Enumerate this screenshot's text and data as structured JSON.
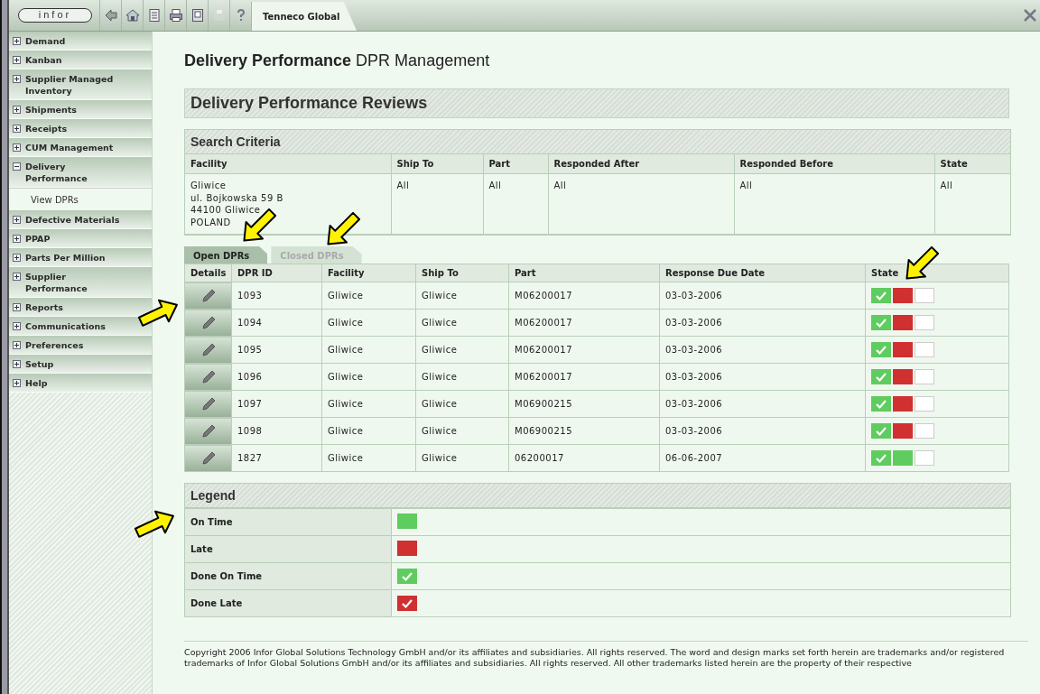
{
  "topbar": {
    "logo": "infor",
    "toolbar": [
      {
        "kind": "back",
        "disabled": false
      },
      {
        "kind": "home",
        "disabled": false
      },
      {
        "kind": "document",
        "disabled": false
      },
      {
        "kind": "print",
        "disabled": false
      },
      {
        "kind": "page",
        "disabled": false
      },
      {
        "kind": "save",
        "disabled": true
      },
      {
        "kind": "help",
        "disabled": false
      }
    ],
    "tab": "Tenneco Global"
  },
  "sidebar": {
    "items": [
      {
        "label": "Demand",
        "expanded": false
      },
      {
        "label": "Kanban",
        "expanded": false
      },
      {
        "label": "Supplier Managed Inventory",
        "expanded": false
      },
      {
        "label": "Shipments",
        "expanded": false
      },
      {
        "label": "Receipts",
        "expanded": false
      },
      {
        "label": "CUM Management",
        "expanded": false
      },
      {
        "label": "Delivery Performance",
        "expanded": true,
        "children": [
          {
            "label": "View DPRs"
          }
        ]
      },
      {
        "label": "Defective Materials",
        "expanded": false
      },
      {
        "label": "PPAP",
        "expanded": false
      },
      {
        "label": "Parts Per Million",
        "expanded": false
      },
      {
        "label": "Supplier Performance",
        "expanded": false
      },
      {
        "label": "Reports",
        "expanded": false
      },
      {
        "label": "Communications",
        "expanded": false
      },
      {
        "label": "Preferences",
        "expanded": false
      },
      {
        "label": "Setup",
        "expanded": false
      },
      {
        "label": "Help",
        "expanded": false
      }
    ]
  },
  "page_title": {
    "bold": "Delivery Performance",
    "rest": "DPR Management"
  },
  "section_title": "Delivery Performance Reviews",
  "search_criteria": {
    "title": "Search Criteria",
    "columns": [
      "Facility",
      "Ship To",
      "Part",
      "Responded After",
      "Responded Before",
      "State"
    ],
    "values": [
      [
        "Gliwice",
        "ul. Bojkowska 59 B",
        "44100 Gliwice",
        "POLAND"
      ],
      [
        "All"
      ],
      [
        "All"
      ],
      [
        "All"
      ],
      [
        "All"
      ],
      [
        "All"
      ]
    ]
  },
  "tabs": [
    {
      "label": "Open DPRs",
      "selected": true
    },
    {
      "label": "Closed DPRs",
      "selected": false
    }
  ],
  "dpr_table": {
    "columns": [
      "Details",
      "DPR ID",
      "Facility",
      "Ship To",
      "Part",
      "Response Due Date",
      "State"
    ],
    "rows": [
      {
        "id": "1093",
        "facility": "Gliwice",
        "ship_to": "Gliwice",
        "part": "M06200017",
        "due": "03-03-2006",
        "state": [
          {
            "kind": "done_on_time"
          },
          {
            "kind": "late"
          },
          {
            "kind": "empty"
          }
        ]
      },
      {
        "id": "1094",
        "facility": "Gliwice",
        "ship_to": "Gliwice",
        "part": "M06200017",
        "due": "03-03-2006",
        "state": [
          {
            "kind": "done_on_time"
          },
          {
            "kind": "late"
          },
          {
            "kind": "empty"
          }
        ]
      },
      {
        "id": "1095",
        "facility": "Gliwice",
        "ship_to": "Gliwice",
        "part": "M06200017",
        "due": "03-03-2006",
        "state": [
          {
            "kind": "done_on_time"
          },
          {
            "kind": "late"
          },
          {
            "kind": "empty"
          }
        ]
      },
      {
        "id": "1096",
        "facility": "Gliwice",
        "ship_to": "Gliwice",
        "part": "M06200017",
        "due": "03-03-2006",
        "state": [
          {
            "kind": "done_on_time"
          },
          {
            "kind": "late"
          },
          {
            "kind": "empty"
          }
        ]
      },
      {
        "id": "1097",
        "facility": "Gliwice",
        "ship_to": "Gliwice",
        "part": "M06900215",
        "due": "03-03-2006",
        "state": [
          {
            "kind": "done_on_time"
          },
          {
            "kind": "late"
          },
          {
            "kind": "empty"
          }
        ]
      },
      {
        "id": "1098",
        "facility": "Gliwice",
        "ship_to": "Gliwice",
        "part": "M06900215",
        "due": "03-03-2006",
        "state": [
          {
            "kind": "done_on_time"
          },
          {
            "kind": "late"
          },
          {
            "kind": "empty"
          }
        ]
      },
      {
        "id": "1827",
        "facility": "Gliwice",
        "ship_to": "Gliwice",
        "part": "06200017",
        "due": "06-06-2007",
        "state": [
          {
            "kind": "done_on_time"
          },
          {
            "kind": "on_time"
          },
          {
            "kind": "empty"
          }
        ]
      }
    ]
  },
  "legend": {
    "title": "Legend",
    "items": [
      {
        "label": "On Time",
        "kind": "on_time"
      },
      {
        "label": "Late",
        "kind": "late"
      },
      {
        "label": "Done On Time",
        "kind": "done_on_time"
      },
      {
        "label": "Done Late",
        "kind": "done_late"
      }
    ]
  },
  "footer": "Copyright 2006 Infor Global Solutions Technology GmbH and/or its affiliates and subsidiaries. All rights reserved. The word and design marks set forth herein are trademarks and/or registered trademarks of Infor Global Solutions GmbH and/or its affiliates and subsidiaries. All rights reserved. All other trademarks listed herein are the property of their respective"
}
